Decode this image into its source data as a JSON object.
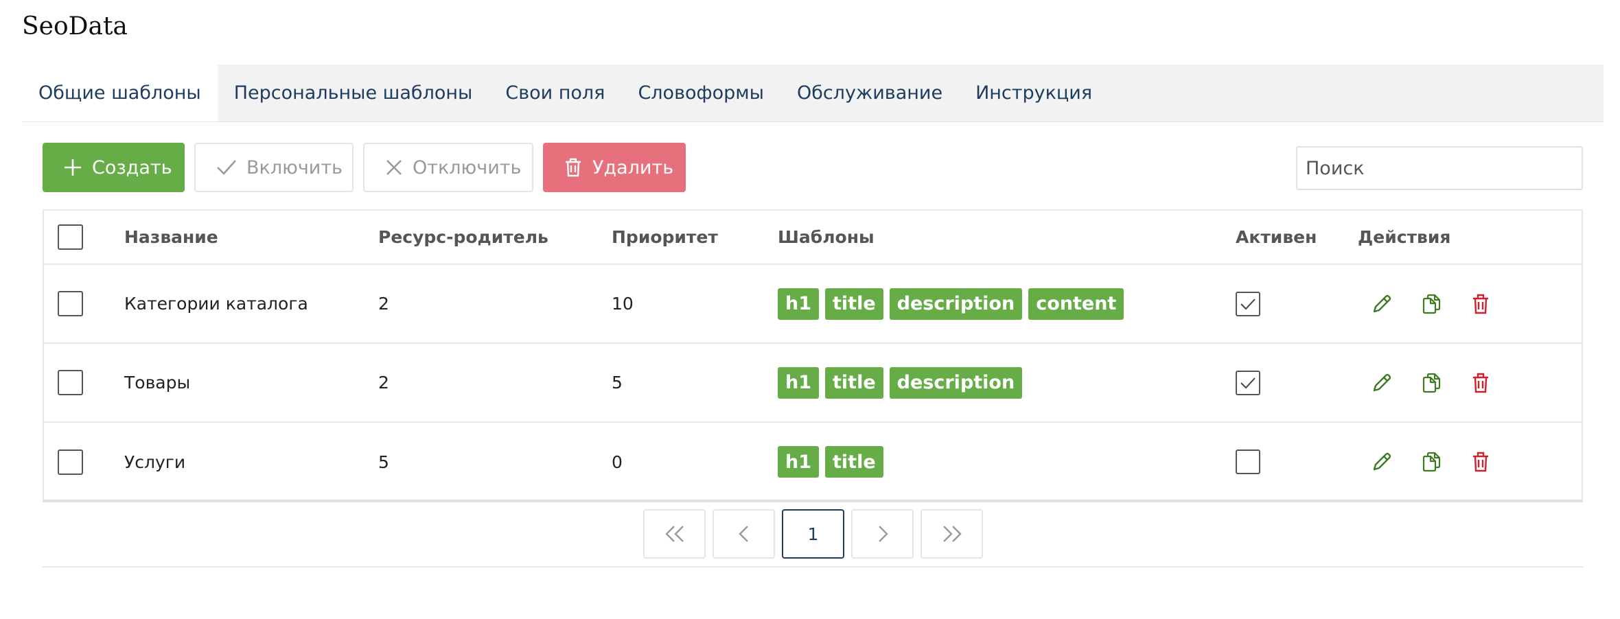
{
  "app": {
    "title": "SeoData"
  },
  "tabs": [
    {
      "label": "Общие шаблоны"
    },
    {
      "label": "Персональные шаблоны"
    },
    {
      "label": "Свои поля"
    },
    {
      "label": "Словоформы"
    },
    {
      "label": "Обслуживание"
    },
    {
      "label": "Инструкция"
    }
  ],
  "toolbar": {
    "create_label": "Создать",
    "enable_label": "Включить",
    "disable_label": "Отключить",
    "delete_label": "Удалить"
  },
  "search": {
    "placeholder": "Поиск"
  },
  "table": {
    "columns": {
      "name": "Название",
      "parent": "Ресурс-родитель",
      "priority": "Приоритет",
      "templates": "Шаблоны",
      "active": "Активен",
      "actions": "Действия"
    },
    "rows": [
      {
        "name": "Категории каталога",
        "parent": "2",
        "priority": "10",
        "templates": [
          "h1",
          "title",
          "description",
          "content"
        ],
        "active": true
      },
      {
        "name": "Товары",
        "parent": "2",
        "priority": "5",
        "templates": [
          "h1",
          "title",
          "description"
        ],
        "active": true
      },
      {
        "name": "Услуги",
        "parent": "5",
        "priority": "0",
        "templates": [
          "h1",
          "title"
        ],
        "active": false
      }
    ]
  },
  "pagination": {
    "current_page": "1"
  },
  "colors": {
    "accent_green": "#66ad47",
    "danger_red": "#e6707b",
    "link_blue": "#1d3c5e",
    "icon_green": "#3d7a22",
    "icon_red": "#d0202e"
  }
}
